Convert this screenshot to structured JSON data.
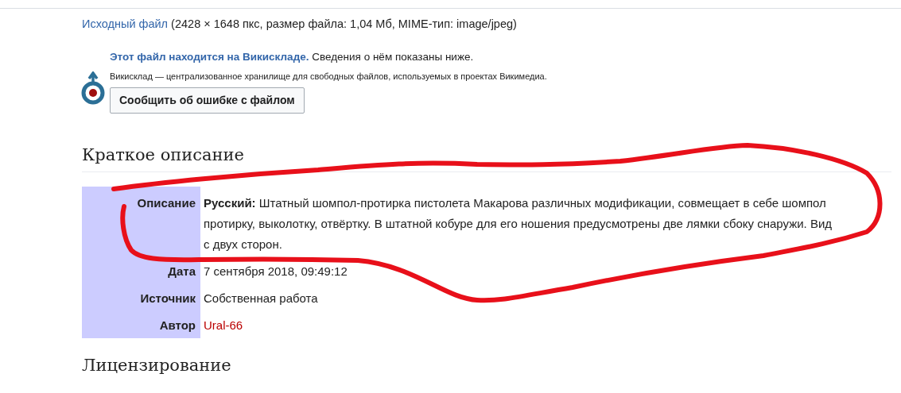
{
  "file_info": {
    "link": "Исходный файл",
    "details": "(2428 × 1648 пкс, размер файла: 1,04 Мб, MIME-тип: image/jpeg)"
  },
  "commons_notice": {
    "link": "Этот файл находится на Викискладе.",
    "text": "Сведения о нём показаны ниже.",
    "subtext": "Викисклад — централизованное хранилище для свободных файлов, используемых в проектах Викимедиа.",
    "button": "Сообщить об ошибке с файлом"
  },
  "summary": {
    "heading": "Краткое описание",
    "rows": [
      {
        "label": "Описание",
        "value": "**Русский:** Штатный шомпол-протирка пистолета Макарова различных модификации, совмещает в себе шомпол протирку, выколотку, отвёртку. В штатной кобуре для его ношения предусмотрены две лямки сбоку снаружи. Вид с двух сторон.",
        "kind": "text"
      },
      {
        "label": "Дата",
        "value": "7 сентября 2018, 09:49:12",
        "kind": "text"
      },
      {
        "label": "Источник",
        "value": "Собственная работа",
        "kind": "text"
      },
      {
        "label": "Автор",
        "value": "Ural-66",
        "kind": "redlink"
      }
    ]
  },
  "licensing": {
    "heading": "Лицензирование"
  }
}
